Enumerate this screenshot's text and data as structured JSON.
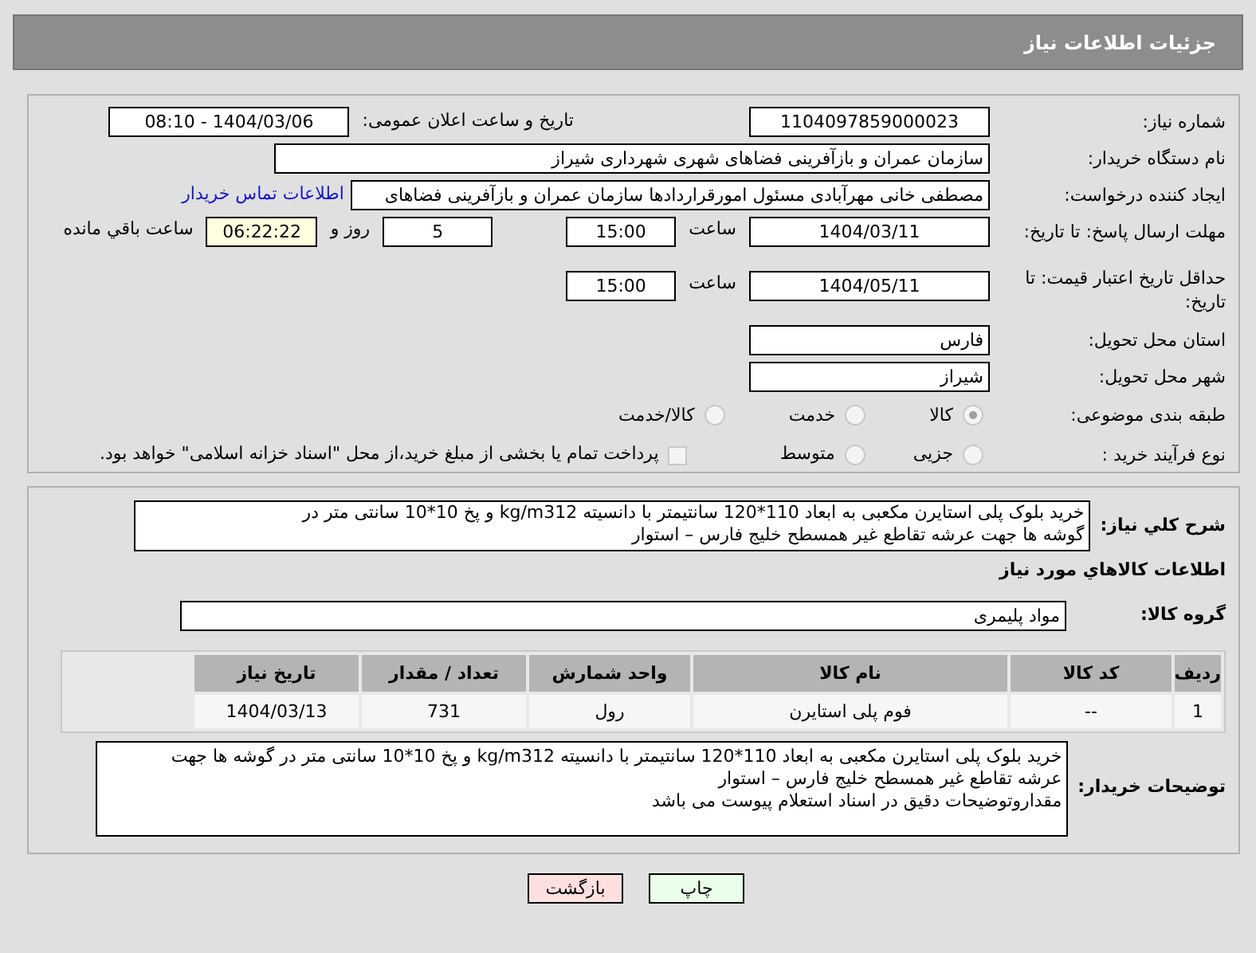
{
  "header": {
    "title": "جزئیات اطلاعات نیاز"
  },
  "need_number": {
    "label": "شماره نیاز:",
    "value": "1104097859000023"
  },
  "announce": {
    "label": "تاریخ و ساعت اعلان عمومی:",
    "value": "1404/03/06 - 08:10"
  },
  "buyer_org": {
    "label": "نام دستگاه خریدار:",
    "value": "سازمان عمران و بازآفرینی فضاهای شهری شهرداری شیراز"
  },
  "creator": {
    "label": "ایجاد کننده درخواست:",
    "value": "مصطفی خانی مهرآبادی مسئول امورقراردادها سازمان عمران و بازآفرینی فضاهای",
    "link": "اطلاعات تماس خریدار"
  },
  "deadline": {
    "label": "مهلت ارسال پاسخ: تا تاریخ:",
    "date": "1404/03/11",
    "time_label": "ساعت",
    "time": "15:00",
    "days": "5",
    "days_label": "روز و",
    "remaining": "06:22:22",
    "remaining_label": "ساعت باقي مانده"
  },
  "validity": {
    "label": "حداقل تاریخ اعتبار قیمت: تا تاریخ:",
    "date": "1404/05/11",
    "time_label": "ساعت",
    "time": "15:00"
  },
  "province": {
    "label": "استان محل تحویل:",
    "value": "فارس"
  },
  "city": {
    "label": "شهر محل تحویل:",
    "value": "شیراز"
  },
  "category": {
    "label": "طبقه بندی موضوعی:",
    "options": [
      {
        "label": "کالا",
        "selected": true
      },
      {
        "label": "خدمت",
        "selected": false
      },
      {
        "label": "کالا/خدمت",
        "selected": false
      }
    ]
  },
  "process": {
    "label": "نوع فرآیند خرید :",
    "options": [
      {
        "label": "جزیی",
        "selected": false
      },
      {
        "label": "متوسط",
        "selected": false
      }
    ],
    "payment": {
      "label": "پرداخت تمام یا بخشی از مبلغ خرید،از محل \"اسناد خزانه اسلامی\" خواهد بود.",
      "checked": false
    }
  },
  "summary": {
    "label": "شرح کلي نياز:",
    "lines": [
      "خرید بلوک پلی استایرن مکعبی به ابعاد 110*120 سانتیمتر با دانسیته kg/m312 و پخ 10*10 سانتی متر در",
      "گوشه ها جهت عرشه تقاطع غیر همسطح خلیج فارس – استوار"
    ]
  },
  "goods_title": "اطلاعات کالاهاي مورد نياز",
  "goods_group": {
    "label": "گروه کالا:",
    "value": "مواد پلیمری"
  },
  "table": {
    "columns": [
      "ردیف",
      "کد کالا",
      "نام کالا",
      "واحد شمارش",
      "تعداد / مقدار",
      "تاریخ نیاز"
    ],
    "rows": [
      [
        "1",
        "--",
        "فوم پلی استایرن",
        "رول",
        "731",
        "1404/03/13"
      ]
    ]
  },
  "notes": {
    "label": "توضیحات خریدار:",
    "lines": [
      "خرید بلوک پلی استایرن مکعبی به ابعاد 110*120 سانتیمتر با دانسیته kg/m312 و پخ 10*10 سانتی متر در گوشه ها جهت",
      "عرشه تقاطع غیر همسطح خلیج فارس – استوار",
      "مقداروتوضیحات دقیق در اسناد استعلام پیوست می باشد"
    ]
  },
  "buttons": [
    {
      "label": "چاپ",
      "kind": "print"
    },
    {
      "label": "بازگشت",
      "kind": "back"
    }
  ]
}
